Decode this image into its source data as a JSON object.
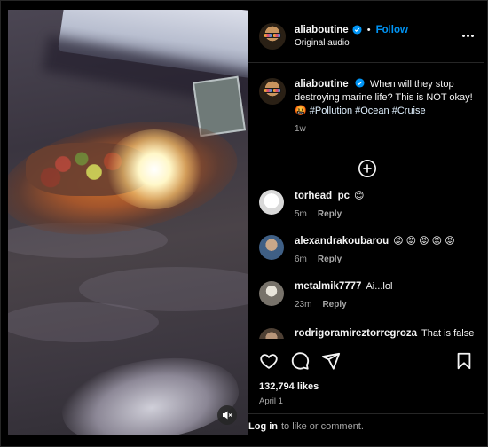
{
  "post": {
    "username": "aliaboutine",
    "follow_label": "Follow",
    "separator": "•",
    "audio": "Original audio",
    "colors": {
      "accent": "#0095f6",
      "verified": "#0095f6",
      "background": "#000000",
      "muted_text": "#a8a8a8"
    }
  },
  "caption": {
    "username": "aliaboutine",
    "text": "When will they stop destroying marine life? This is NOT okay! 🤬 ",
    "hashtags": "#Pollution #Ocean #Cruise",
    "time": "1w"
  },
  "comments": [
    {
      "username": "torhead_pc",
      "text": "😊",
      "time": "5m",
      "reply": "Reply",
      "avatar_color": "#e8e8e8"
    },
    {
      "username": "alexandrakoubarou",
      "text": "😡 😡 😡 😡 😡",
      "time": "6m",
      "reply": "Reply",
      "avatar_color": "#5a7fa8"
    },
    {
      "username": "metalmik7777",
      "text": "Ai...lol",
      "time": "23m",
      "reply": "Reply",
      "avatar_color": "#8f8a80"
    },
    {
      "username": "rodrigoramireztorregroza",
      "text": "That is false",
      "time": "",
      "reply": "",
      "avatar_color": "#6d5a4a"
    }
  ],
  "engagement": {
    "likes": "132,794 likes",
    "date": "April 1"
  },
  "footer": {
    "login_label": "Log in",
    "login_suffix": "to like or comment."
  },
  "icons": {
    "like": "heart-icon",
    "comment": "comment-icon",
    "share": "share-icon",
    "save": "bookmark-icon",
    "more": "more-options-icon",
    "add": "plus-circle-icon",
    "mute": "muted-speaker-icon"
  }
}
